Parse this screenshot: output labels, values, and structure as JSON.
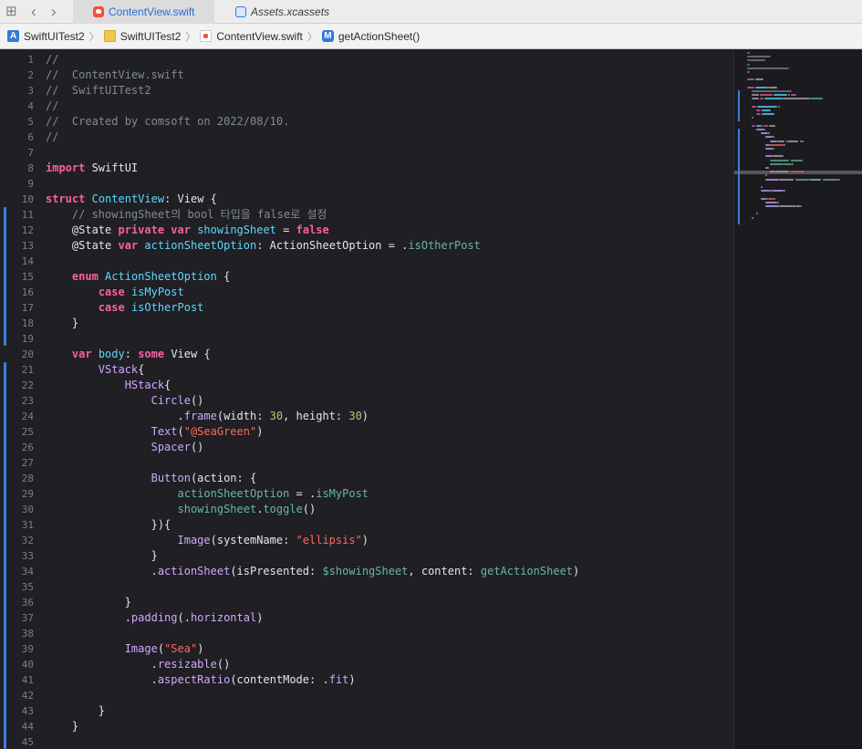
{
  "tabs": [
    {
      "label": "ContentView.swift",
      "active": true,
      "icon": "swift-file-icon"
    },
    {
      "label": "Assets.xcassets",
      "active": false,
      "icon": "asset-catalog-icon"
    }
  ],
  "breadcrumb": [
    {
      "label": "SwiftUITest2",
      "icon": "project-icon"
    },
    {
      "label": "SwiftUITest2",
      "icon": "folder-icon"
    },
    {
      "label": "ContentView.swift",
      "icon": "swift-file-icon"
    },
    {
      "label": "getActionSheet()",
      "icon": "method-icon"
    }
  ],
  "breadcrumb_separator": "〉",
  "colors": {
    "editor_bg": "#1f1f24",
    "comment": "#7f8c98",
    "keyword": "#fc5fa3",
    "type": "#5dd8ff",
    "function": "#67b7a4",
    "property": "#d0a8ff",
    "string": "#fc6a5d",
    "number": "#d0bf69",
    "change_bar": "#3d7de0"
  },
  "code_lines": [
    {
      "n": "1",
      "tokens": [
        {
          "c": "c",
          "t": "//"
        }
      ]
    },
    {
      "n": "2",
      "tokens": [
        {
          "c": "c",
          "t": "//  ContentView.swift"
        }
      ]
    },
    {
      "n": "3",
      "tokens": [
        {
          "c": "c",
          "t": "//  SwiftUITest2"
        }
      ]
    },
    {
      "n": "4",
      "tokens": [
        {
          "c": "c",
          "t": "//"
        }
      ]
    },
    {
      "n": "5",
      "tokens": [
        {
          "c": "c",
          "t": "//  Created by comsoft on 2022/08/10."
        }
      ]
    },
    {
      "n": "6",
      "tokens": [
        {
          "c": "c",
          "t": "//"
        }
      ]
    },
    {
      "n": "7",
      "tokens": []
    },
    {
      "n": "8",
      "tokens": [
        {
          "c": "k",
          "t": "import"
        },
        {
          "c": "x",
          "t": " SwiftUI"
        }
      ]
    },
    {
      "n": "9",
      "tokens": []
    },
    {
      "n": "10",
      "tokens": [
        {
          "c": "k",
          "t": "struct"
        },
        {
          "c": "x",
          "t": " "
        },
        {
          "c": "t",
          "t": "ContentView"
        },
        {
          "c": "x",
          "t": ": View {"
        }
      ]
    },
    {
      "n": "11",
      "tokens": [
        {
          "c": "c",
          "t": "    // showingSheet의 bool 타입을 false로 설정"
        }
      ]
    },
    {
      "n": "12",
      "tokens": [
        {
          "c": "x",
          "t": "    @State "
        },
        {
          "c": "k",
          "t": "private var"
        },
        {
          "c": "x",
          "t": " "
        },
        {
          "c": "t",
          "t": "showingSheet"
        },
        {
          "c": "x",
          "t": " = "
        },
        {
          "c": "k",
          "t": "false"
        }
      ]
    },
    {
      "n": "13",
      "tokens": [
        {
          "c": "x",
          "t": "    @State "
        },
        {
          "c": "k",
          "t": "var"
        },
        {
          "c": "x",
          "t": " "
        },
        {
          "c": "t",
          "t": "actionSheetOption"
        },
        {
          "c": "x",
          "t": ": ActionSheetOption = ."
        },
        {
          "c": "f",
          "t": "isOtherPost"
        }
      ]
    },
    {
      "n": "14",
      "tokens": []
    },
    {
      "n": "15",
      "tokens": [
        {
          "c": "x",
          "t": "    "
        },
        {
          "c": "k",
          "t": "enum"
        },
        {
          "c": "x",
          "t": " "
        },
        {
          "c": "t",
          "t": "ActionSheetOption"
        },
        {
          "c": "x",
          "t": " {"
        }
      ]
    },
    {
      "n": "16",
      "tokens": [
        {
          "c": "x",
          "t": "        "
        },
        {
          "c": "k",
          "t": "case"
        },
        {
          "c": "x",
          "t": " "
        },
        {
          "c": "t",
          "t": "isMyPost"
        }
      ]
    },
    {
      "n": "17",
      "tokens": [
        {
          "c": "x",
          "t": "        "
        },
        {
          "c": "k",
          "t": "case"
        },
        {
          "c": "x",
          "t": " "
        },
        {
          "c": "t",
          "t": "isOtherPost"
        }
      ]
    },
    {
      "n": "18",
      "tokens": [
        {
          "c": "x",
          "t": "    }"
        }
      ]
    },
    {
      "n": "19",
      "tokens": []
    },
    {
      "n": "20",
      "tokens": [
        {
          "c": "x",
          "t": "    "
        },
        {
          "c": "k",
          "t": "var"
        },
        {
          "c": "x",
          "t": " "
        },
        {
          "c": "t",
          "t": "body"
        },
        {
          "c": "x",
          "t": ": "
        },
        {
          "c": "k",
          "t": "some"
        },
        {
          "c": "x",
          "t": " View {"
        }
      ]
    },
    {
      "n": "21",
      "tokens": [
        {
          "c": "p",
          "t": "        VStack"
        },
        {
          "c": "x",
          "t": "{"
        }
      ]
    },
    {
      "n": "22",
      "tokens": [
        {
          "c": "p",
          "t": "            HStack"
        },
        {
          "c": "x",
          "t": "{"
        }
      ]
    },
    {
      "n": "23",
      "tokens": [
        {
          "c": "p",
          "t": "                Circle"
        },
        {
          "c": "x",
          "t": "()"
        }
      ]
    },
    {
      "n": "24",
      "tokens": [
        {
          "c": "x",
          "t": "                    ."
        },
        {
          "c": "p",
          "t": "frame"
        },
        {
          "c": "x",
          "t": "(width: "
        },
        {
          "c": "n",
          "t": "30"
        },
        {
          "c": "x",
          "t": ", height: "
        },
        {
          "c": "n",
          "t": "30"
        },
        {
          "c": "x",
          "t": ")"
        }
      ]
    },
    {
      "n": "25",
      "tokens": [
        {
          "c": "p",
          "t": "                Text"
        },
        {
          "c": "x",
          "t": "("
        },
        {
          "c": "s",
          "t": "\"@SeaGreen\""
        },
        {
          "c": "x",
          "t": ")"
        }
      ]
    },
    {
      "n": "26",
      "tokens": [
        {
          "c": "p",
          "t": "                Spacer"
        },
        {
          "c": "x",
          "t": "()"
        }
      ]
    },
    {
      "n": "27",
      "tokens": []
    },
    {
      "n": "28",
      "tokens": [
        {
          "c": "p",
          "t": "                Button"
        },
        {
          "c": "x",
          "t": "(action: {"
        }
      ]
    },
    {
      "n": "29",
      "tokens": [
        {
          "c": "f",
          "t": "                    actionSheetOption"
        },
        {
          "c": "x",
          "t": " = ."
        },
        {
          "c": "f",
          "t": "isMyPost"
        }
      ]
    },
    {
      "n": "30",
      "tokens": [
        {
          "c": "f",
          "t": "                    showingSheet"
        },
        {
          "c": "x",
          "t": "."
        },
        {
          "c": "f",
          "t": "toggle"
        },
        {
          "c": "x",
          "t": "()"
        }
      ]
    },
    {
      "n": "31",
      "tokens": [
        {
          "c": "x",
          "t": "                }){"
        }
      ]
    },
    {
      "n": "32",
      "tokens": [
        {
          "c": "p",
          "t": "                    Image"
        },
        {
          "c": "x",
          "t": "(systemName: "
        },
        {
          "c": "s",
          "t": "\"ellipsis\""
        },
        {
          "c": "x",
          "t": ")"
        }
      ]
    },
    {
      "n": "33",
      "tokens": [
        {
          "c": "x",
          "t": "                }"
        }
      ]
    },
    {
      "n": "34",
      "tokens": [
        {
          "c": "x",
          "t": "                ."
        },
        {
          "c": "p",
          "t": "actionSheet"
        },
        {
          "c": "x",
          "t": "(isPresented: "
        },
        {
          "c": "f",
          "t": "$showingSheet"
        },
        {
          "c": "x",
          "t": ", content: "
        },
        {
          "c": "f",
          "t": "getActionSheet"
        },
        {
          "c": "x",
          "t": ")"
        }
      ]
    },
    {
      "n": "35",
      "tokens": []
    },
    {
      "n": "36",
      "tokens": [
        {
          "c": "x",
          "t": "            }"
        }
      ]
    },
    {
      "n": "37",
      "tokens": [
        {
          "c": "x",
          "t": "            ."
        },
        {
          "c": "p",
          "t": "padding"
        },
        {
          "c": "x",
          "t": "(."
        },
        {
          "c": "p",
          "t": "horizontal"
        },
        {
          "c": "x",
          "t": ")"
        }
      ]
    },
    {
      "n": "38",
      "tokens": []
    },
    {
      "n": "39",
      "tokens": [
        {
          "c": "p",
          "t": "            Image"
        },
        {
          "c": "x",
          "t": "("
        },
        {
          "c": "s",
          "t": "\"Sea\""
        },
        {
          "c": "x",
          "t": ")"
        }
      ]
    },
    {
      "n": "40",
      "tokens": [
        {
          "c": "x",
          "t": "                ."
        },
        {
          "c": "p",
          "t": "resizable"
        },
        {
          "c": "x",
          "t": "()"
        }
      ]
    },
    {
      "n": "41",
      "tokens": [
        {
          "c": "x",
          "t": "                ."
        },
        {
          "c": "p",
          "t": "aspectRatio"
        },
        {
          "c": "x",
          "t": "(contentMode: ."
        },
        {
          "c": "p",
          "t": "fit"
        },
        {
          "c": "x",
          "t": ")"
        }
      ]
    },
    {
      "n": "42",
      "tokens": []
    },
    {
      "n": "43",
      "tokens": [
        {
          "c": "x",
          "t": "        }"
        }
      ]
    },
    {
      "n": "44",
      "tokens": [
        {
          "c": "x",
          "t": "    }"
        }
      ]
    },
    {
      "n": "45",
      "tokens": []
    }
  ]
}
